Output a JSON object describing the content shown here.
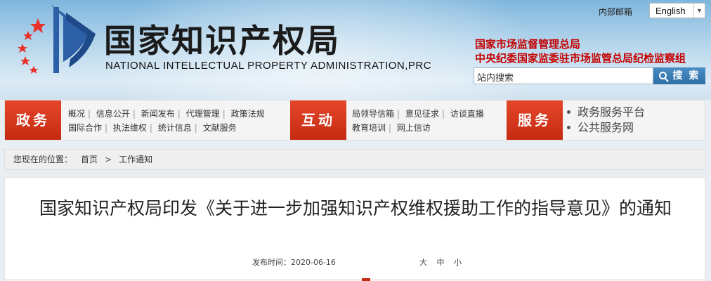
{
  "header": {
    "title": "国家知识产权局",
    "subtitle": "NATIONAL INTELLECTUAL PROPERTY ADMINISTRATION,PRC",
    "mailbox": "内部邮箱",
    "language": "English",
    "agencies": [
      "国家市场监督管理总局",
      "中央纪委国家监委驻市场监管总局纪检监察组"
    ],
    "search": {
      "value": "站内搜索",
      "button": "搜 索"
    }
  },
  "nav": {
    "sections": [
      {
        "label": "政务",
        "rows": [
          [
            "概况",
            "信息公开",
            "新闻发布",
            "代理管理",
            "政策法规"
          ],
          [
            "国际合作",
            "执法维权",
            "统计信息",
            "文献服务"
          ]
        ]
      },
      {
        "label": "互动",
        "rows": [
          [
            "局领导信箱",
            "意见征求",
            "访谈直播"
          ],
          [
            "教育培训",
            "网上信访"
          ]
        ]
      },
      {
        "label": "服务",
        "items": [
          "政务服务平台",
          "公共服务网"
        ]
      }
    ]
  },
  "breadcrumb": {
    "prefix": "您现在的位置：",
    "items": [
      "首页",
      "工作通知"
    ]
  },
  "article": {
    "title": "国家知识产权局印发《关于进一步加强知识产权维权援助工作的指导意见》的通知",
    "date_label": "发布时间：",
    "date": "2020-06-16",
    "font_sizes": [
      "大",
      "中",
      "小"
    ]
  },
  "colors": {
    "accent": "#c52a11",
    "brand_blue": "#2f6fa8"
  }
}
